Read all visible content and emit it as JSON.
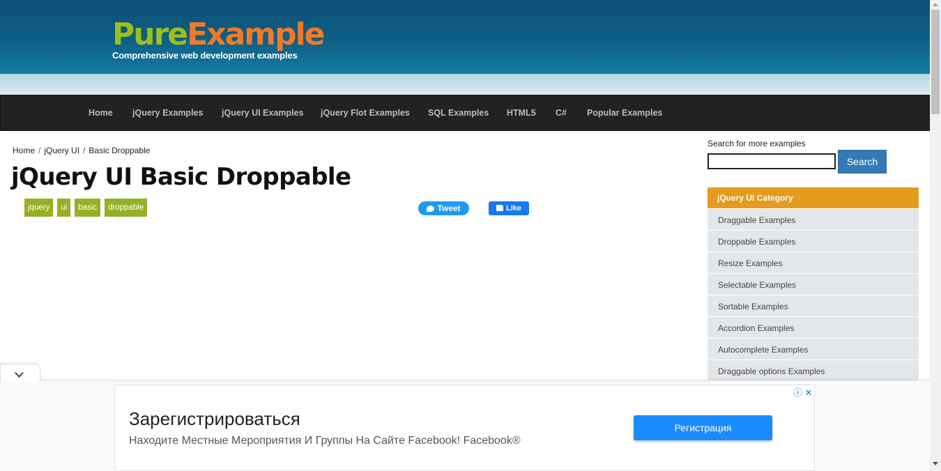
{
  "header": {
    "logo_pure": "Pure",
    "logo_example": "Example",
    "tagline": "Comprehensive web development examples"
  },
  "nav": {
    "items": [
      "Home",
      "jQuery Examples",
      "jQuery UI Examples",
      "jQuery Flot Examples",
      "SQL Examples",
      "HTML5",
      "C#",
      "Popular Examples"
    ]
  },
  "breadcrumb": {
    "items": [
      "Home",
      "jQuery UI",
      "Basic Droppable"
    ],
    "separator": "/"
  },
  "main": {
    "title": "jQuery UI Basic Droppable",
    "tags": [
      "jquery",
      "ui",
      "basic",
      "droppable"
    ],
    "tweet_label": "Tweet",
    "like_label": "Like"
  },
  "sidebar": {
    "search_label": "Search for more examples",
    "search_value": "",
    "search_button": "Search",
    "category_title": "jQuery UI Category",
    "categories": [
      "Draggable Examples",
      "Droppable Examples",
      "Resize Examples",
      "Selectable Examples",
      "Sortable Examples",
      "Accordion Examples",
      "Autocomplete Examples",
      "Draggable options Examples"
    ]
  },
  "ad": {
    "title": "Зарегистрироваться",
    "description": "Находите Местные Мероприятия И Группы На Сайте Facebook! Facebook®",
    "button": "Регистрация",
    "icons": "ⓘ ✕"
  },
  "colors": {
    "header_bg": "#0f5f86",
    "nav_bg": "#222222",
    "tag_bg": "#94b125",
    "category_header": "#e49b1e",
    "category_item": "#e4e7ea",
    "search_button": "#337ab7",
    "ad_button": "#1a8cff"
  }
}
